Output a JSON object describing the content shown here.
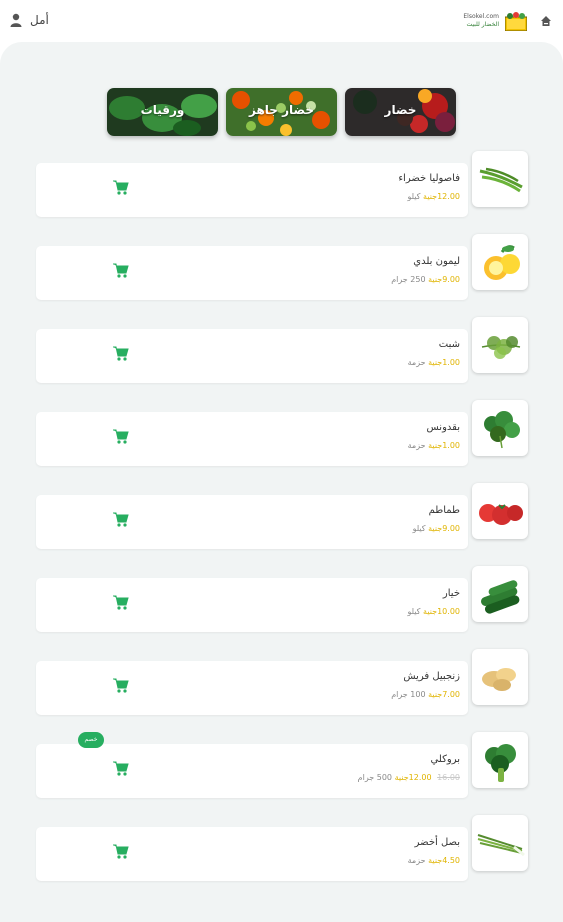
{
  "header": {
    "user_name": "أمل",
    "brand_en": "Elsokel.com",
    "brand_ar": "الخضار للبيت",
    "user_icon": "user-icon",
    "menu_icon": "home-icon"
  },
  "categories": [
    {
      "label": "خضار",
      "icon": "vegetables-photo"
    },
    {
      "label": "خضار جاهز",
      "icon": "prepared-vegetables-photo"
    },
    {
      "label": "ورقيات",
      "icon": "leafy-greens-photo"
    }
  ],
  "products": [
    {
      "name": "فاصوليا خضراء",
      "price": "12.00جنية",
      "unit": "كيلو",
      "old_price": "",
      "badge": "",
      "icon": "green-beans-image"
    },
    {
      "name": "ليمون بلدي",
      "price": "9.00جنية",
      "unit": "250 جرام",
      "old_price": "",
      "badge": "",
      "icon": "lemon-image"
    },
    {
      "name": "شبت",
      "price": "1.00جنية",
      "unit": "حزمة",
      "old_price": "",
      "badge": "",
      "icon": "dill-image"
    },
    {
      "name": "بقدونس",
      "price": "1.00جنية",
      "unit": "حزمة",
      "old_price": "",
      "badge": "",
      "icon": "parsley-image"
    },
    {
      "name": "طماطم",
      "price": "9.00جنية",
      "unit": "كيلو",
      "old_price": "",
      "badge": "",
      "icon": "tomato-image"
    },
    {
      "name": "خيار",
      "price": "10.00جنية",
      "unit": "كيلو",
      "old_price": "",
      "badge": "",
      "icon": "cucumber-image"
    },
    {
      "name": "زنجبيل فريش",
      "price": "7.00جنية",
      "unit": "100 جرام",
      "old_price": "",
      "badge": "",
      "icon": "ginger-image"
    },
    {
      "name": "بروكلي",
      "price": "12.00جنية",
      "unit": "500 جرام",
      "old_price": "16.00",
      "badge": "خصم",
      "icon": "broccoli-image"
    },
    {
      "name": "بصل أخضر",
      "price": "4.50جنية",
      "unit": "حزمة",
      "old_price": "",
      "badge": "",
      "icon": "green-onion-image"
    }
  ],
  "colors": {
    "accent": "#27ae60",
    "price": "#e0b400",
    "panel": "#f1f4f4"
  }
}
